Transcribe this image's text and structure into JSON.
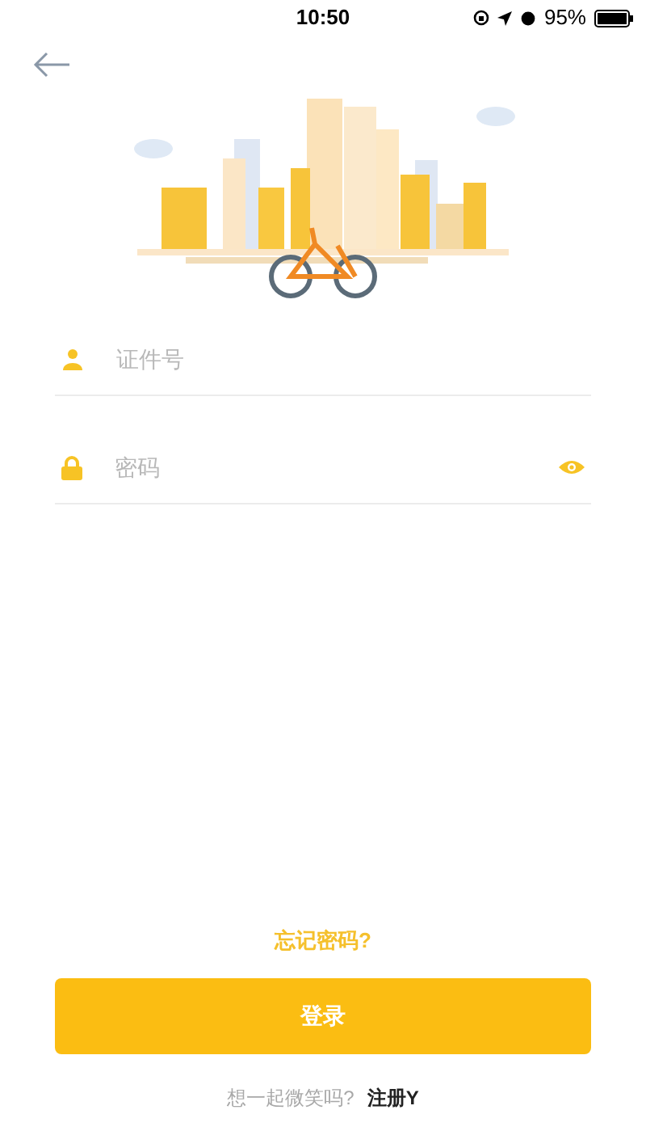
{
  "status_bar": {
    "time": "10:50",
    "battery": "95%"
  },
  "fields": [
    {
      "kind": "user",
      "placeholder": "证件号"
    },
    {
      "kind": "password",
      "placeholder": "密码"
    }
  ],
  "forgot_link": "忘记密码?",
  "login_button": "登录",
  "signup": {
    "prompt": "想一起微笑吗?",
    "link": "注册Y"
  }
}
